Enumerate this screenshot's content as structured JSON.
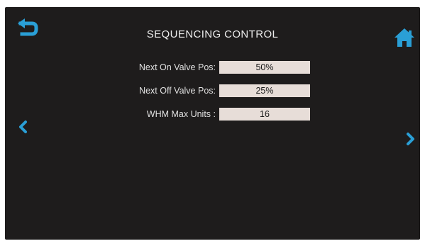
{
  "header": {
    "title": "SEQUENCING CONTROL",
    "back_icon": "back-arrow-icon",
    "home_icon": "home-icon"
  },
  "navigation": {
    "prev_icon": "chevron-left-icon",
    "next_icon": "chevron-right-icon"
  },
  "settings": [
    {
      "label": "Next On Valve Pos:",
      "value": "50%"
    },
    {
      "label": "Next Off Valve Pos:",
      "value": "25%"
    },
    {
      "label": "WHM Max Units :",
      "value": "16"
    }
  ],
  "colors": {
    "background": "#1e1c1c",
    "accent": "#2a9fd6",
    "field": "#e7ddd8",
    "text": "#e0e0e0"
  }
}
